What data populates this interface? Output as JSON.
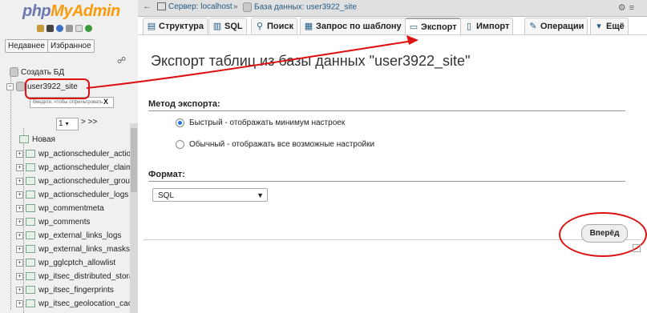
{
  "sidebar": {
    "logo_part1": "php",
    "logo_part2": "MyAdmin",
    "recent_label": "Недавнее",
    "favorites_label": "Избранное",
    "create_db_label": "Создать БД",
    "db_name": "user3922_site",
    "filter_placeholder": "Введите, чтобы отфильтровать",
    "filter_clear": "X",
    "page_value": "1",
    "page_next": "> >>",
    "new_table_label": "Новая",
    "tables": [
      "wp_actionscheduler_action",
      "wp_actionscheduler_claim",
      "wp_actionscheduler_group",
      "wp_actionscheduler_logs",
      "wp_commentmeta",
      "wp_comments",
      "wp_external_links_logs",
      "wp_external_links_masks",
      "wp_gglcptch_allowlist",
      "wp_itsec_distributed_stora",
      "wp_itsec_fingerprints",
      "wp_itsec_geolocation_cach"
    ]
  },
  "topbar": {
    "server_label": "Сервер: localhost",
    "separator": "»",
    "db_label": "База данных: user3922_site"
  },
  "tabs": [
    {
      "label": "Структура",
      "icon": "structure-icon"
    },
    {
      "label": "SQL",
      "icon": "sql-icon"
    },
    {
      "label": "Поиск",
      "icon": "search-icon"
    },
    {
      "label": "Запрос по шаблону",
      "icon": "query-icon"
    },
    {
      "label": "Экспорт",
      "icon": "export-icon"
    },
    {
      "label": "Импорт",
      "icon": "import-icon"
    },
    {
      "label": "Операции",
      "icon": "wrench-icon"
    },
    {
      "label": "Ещё",
      "icon": "chevron-down-icon"
    }
  ],
  "main": {
    "heading": "Экспорт таблиц из базы данных \"user3922_site\"",
    "method_label": "Метод экспорта:",
    "method_quick": "Быстрый - отображать минимум настроек",
    "method_custom": "Обычный - отображать все возможные настройки",
    "format_label": "Формат:",
    "format_value": "SQL",
    "go_button": "Вперёд"
  },
  "colors": {
    "annotation_red": "#dd1111",
    "logo_blue": "#6c78af",
    "logo_orange": "#f89c0e",
    "link_blue": "#235a81"
  }
}
